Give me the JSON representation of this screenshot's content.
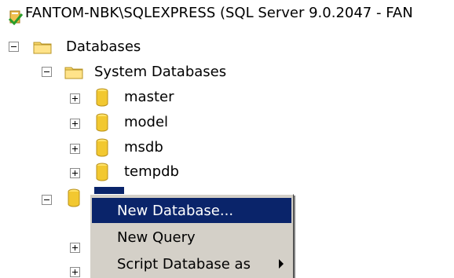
{
  "server": {
    "label": "FANTOM-NBK\\SQLEXPRESS (SQL Server 9.0.2047 - FAN",
    "icon": "server-icon"
  },
  "tree": {
    "databases_label": "Databases",
    "system_databases_label": "System Databases",
    "system_dbs": [
      "master",
      "model",
      "msdb",
      "tempdb"
    ]
  },
  "context_menu": {
    "items": [
      {
        "label": "New Database...",
        "highlighted": true
      },
      {
        "label": "New Query",
        "highlighted": false
      },
      {
        "label": "Script Database as",
        "highlighted": false,
        "has_submenu": true
      }
    ]
  },
  "colors": {
    "selection": "#0a246a",
    "menu_bg": "#d4d0c8"
  }
}
